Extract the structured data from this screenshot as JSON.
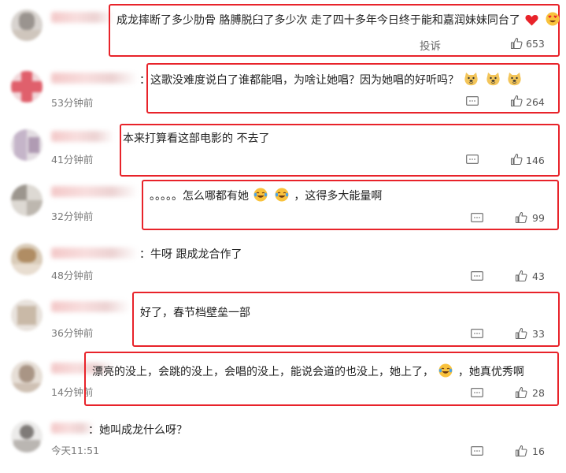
{
  "comments": [
    {
      "time": "",
      "text": "成龙摔断了多少肋骨 胳膊脱臼了多少次 走了四十多年今日终于能和嘉润妹妹同台了",
      "likes": "653",
      "report_label": "投诉"
    },
    {
      "time": "53分钟前",
      "text": "：这歌没难度说白了谁都能唱，为啥让她唱？因为她唱的好听吗？",
      "likes": "264"
    },
    {
      "time": "41分钟前",
      "text": "本来打算看这部电影的 不去了",
      "likes": "146"
    },
    {
      "time": "32分钟前",
      "text_a": "。。。。。怎么哪都有她",
      "text_b": "，这得多大能量啊",
      "likes": "99"
    },
    {
      "time": "48分钟前",
      "text": "：牛呀 跟成龙合作了",
      "likes": "43"
    },
    {
      "time": "36分钟前",
      "text": "好了，春节档壁垒一部",
      "likes": "33"
    },
    {
      "time": "14分钟前",
      "text_a": "漂亮的没上，会跳的没上，会唱的没上，能说会道的也没上，她上了，",
      "text_b": "，她真优秀啊",
      "likes": "28"
    },
    {
      "time": "今天11:51",
      "text": "：她叫成龙什么呀？",
      "likes": "16"
    }
  ],
  "colors": {
    "highlight_border": "#e8232a",
    "text": "#222222",
    "meta": "#7a7a7a"
  },
  "icons": [
    "heart-icon",
    "heart-eyes-emoji",
    "doge-emoji",
    "laugh-cry-emoji",
    "comment-icon",
    "thumb-up-icon"
  ]
}
